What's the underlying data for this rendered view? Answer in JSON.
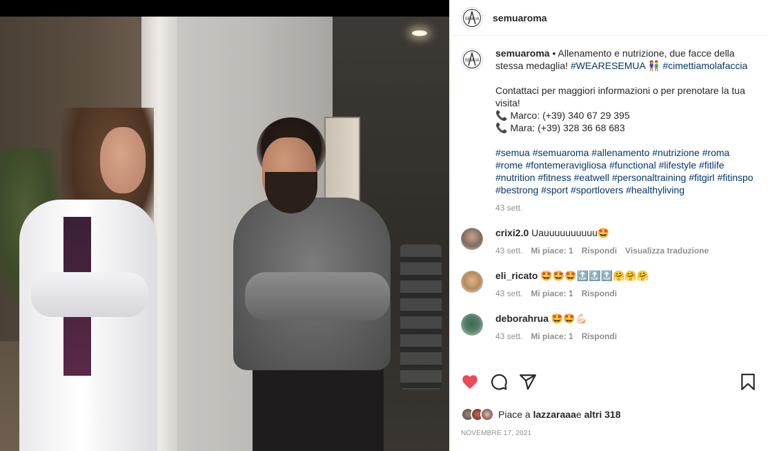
{
  "post": {
    "username": "semuaroma",
    "caption": {
      "author": "semuaroma",
      "separator": " • ",
      "text_1": "Allenamento e nutrizione, due facce della stessa medaglia! ",
      "tag_1": "#WEARESEMUA",
      "emoji_1": " 👫 ",
      "tag_2": "#cimettiamolafaccia",
      "paragraph_2": "Contattaci per maggiori informazioni o per prenotare la tua visita!",
      "phone_1": "Marco: (+39) 340 67 29 395",
      "phone_2": "Mara: (+39) 328 36 68 683",
      "hashtags": [
        "#semua",
        "#semuaroma",
        "#allenamento",
        "#nutrizione",
        "#roma",
        "#rome",
        "#fontemeravigliosa",
        "#functional",
        "#lifestyle",
        "#fitlife",
        "#nutrition",
        "#fitness",
        "#eatwell",
        "#personaltraining",
        "#fitgirl",
        "#fitinspo",
        "#bestrong",
        "#sport",
        "#sportlovers",
        "#healthyliving"
      ],
      "time": "43 sett."
    },
    "comments": [
      {
        "username": "crixi2.0",
        "text": "Uauuuuuuuuuu🤩",
        "time": "43 sett.",
        "likes": "Mi piace: 1",
        "reply": "Rispondi",
        "translate": "Visualizza traduzione"
      },
      {
        "username": "eli_ricato",
        "text": "🤩🤩🤩🔝🔝🔝🤗🤗🤗",
        "time": "43 sett.",
        "likes": "Mi piace: 1",
        "reply": "Rispondi"
      },
      {
        "username": "deborahrua",
        "text": "🤩🤩💪🏻",
        "time": "43 sett.",
        "likes": "Mi piace: 1",
        "reply": "Rispondi"
      }
    ],
    "likes": {
      "prefix": "Piace a ",
      "user": "lazzaraaa",
      "middle": " e ",
      "others": "altri 318"
    },
    "date": "NOVEMBRE 17, 2021",
    "colors": {
      "like": "#ed4956",
      "link": "#00376b",
      "muted": "#8e8e8e"
    }
  }
}
